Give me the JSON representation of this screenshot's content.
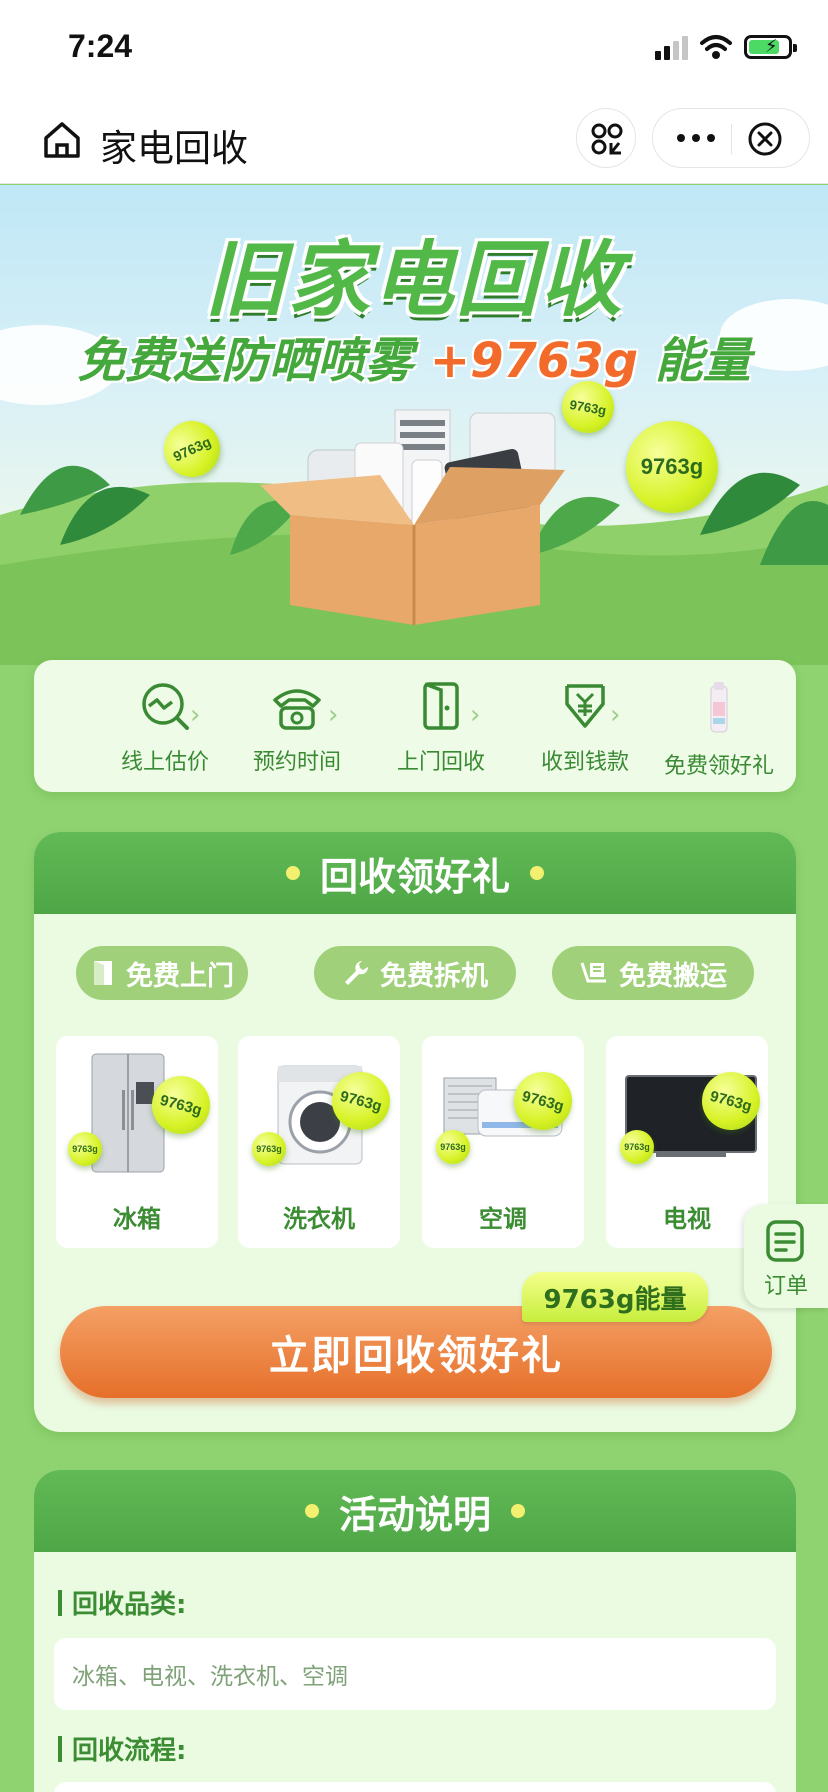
{
  "status": {
    "time": "7:24"
  },
  "nav": {
    "title": "家电回收"
  },
  "hero": {
    "title": "旧家电回收",
    "subtitle_main": "免费送防晒喷雾",
    "subtitle_energy": "+9763g",
    "subtitle_suffix": "能量",
    "bubbles": [
      "9763g",
      "9763g",
      "9763g"
    ]
  },
  "steps": [
    {
      "label": "线上估价",
      "icon": "price-estimate-icon"
    },
    {
      "label": "预约时间",
      "icon": "phone-icon"
    },
    {
      "label": "上门回收",
      "icon": "door-icon"
    },
    {
      "label": "收到钱款",
      "icon": "yuan-icon"
    },
    {
      "label": "免费领好礼",
      "icon": "gift-spray-icon"
    }
  ],
  "recycle": {
    "title": "回收领好礼",
    "services": [
      {
        "label": "免费上门",
        "icon": "door-icon"
      },
      {
        "label": "免费拆机",
        "icon": "wrench-icon"
      },
      {
        "label": "免费搬运",
        "icon": "cart-icon"
      }
    ],
    "appliances": [
      {
        "name": "冰箱",
        "badge": "9763g",
        "badge_small": "9763g"
      },
      {
        "name": "洗衣机",
        "badge": "9763g",
        "badge_small": "9763g"
      },
      {
        "name": "空调",
        "badge": "9763g",
        "badge_small": "9763g"
      },
      {
        "name": "电视",
        "badge": "9763g",
        "badge_small": "9763g"
      }
    ],
    "cta_badge": "9763g能量",
    "cta_label": "立即回收领好礼"
  },
  "order": {
    "label": "订单"
  },
  "rules": {
    "title": "活动说明",
    "category_title": "回收品类:",
    "category_value": "冰箱、电视、洗衣机、空调",
    "process_title": "回收流程:"
  },
  "colors": {
    "primary_green": "#4ea646",
    "accent_orange": "#e66f2a",
    "energy_yellow": "#d6f224"
  }
}
